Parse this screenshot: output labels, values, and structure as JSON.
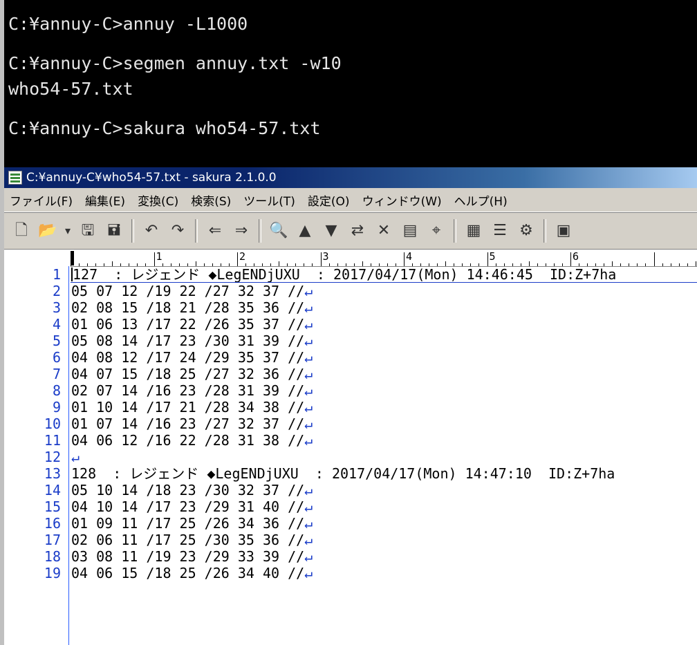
{
  "console": {
    "lines": [
      "C:¥annuy-C>annuy -L1000",
      "",
      "C:¥annuy-C>segmen annuy.txt -w10",
      "who54-57.txt",
      "",
      "C:¥annuy-C>sakura who54-57.txt"
    ]
  },
  "window": {
    "title": "C:¥annuy-C¥who54-57.txt - sakura 2.1.0.0"
  },
  "menu": [
    "ファイル(F)",
    "編集(E)",
    "変換(C)",
    "検索(S)",
    "ツール(T)",
    "設定(O)",
    "ウィンドウ(W)",
    "ヘルプ(H)"
  ],
  "toolbar": {
    "icons": [
      "new-file-icon",
      "open-file-icon",
      "dropdown-arrow-icon",
      "save-icon",
      "save-all-icon",
      "sep",
      "undo-icon",
      "redo-icon",
      "sep",
      "jump-back-icon",
      "jump-forward-icon",
      "sep",
      "find-icon",
      "find-prev-icon",
      "find-next-icon",
      "replace-icon",
      "find-clear-icon",
      "grep-icon",
      "tag-jump-icon",
      "sep",
      "compare-icon",
      "outline-icon",
      "settings-icon",
      "sep",
      "window-list-icon"
    ]
  },
  "ruler": {
    "labels": [
      "1",
      "2",
      "3",
      "4",
      "5",
      "6"
    ]
  },
  "editor": {
    "lines": [
      {
        "n": "1",
        "text": "127  : レジェンド ◆LegENDjUXU  : 2017/04/17(Mon) 14:46:45  ID:Z+7ha",
        "eol": ""
      },
      {
        "n": "2",
        "text": "05 07 12 /19 22 /27 32 37 //",
        "eol": "↵"
      },
      {
        "n": "3",
        "text": "02 08 15 /18 21 /28 35 36 //",
        "eol": "↵"
      },
      {
        "n": "4",
        "text": "01 06 13 /17 22 /26 35 37 //",
        "eol": "↵"
      },
      {
        "n": "5",
        "text": "05 08 14 /17 23 /30 31 39 //",
        "eol": "↵"
      },
      {
        "n": "6",
        "text": "04 08 12 /17 24 /29 35 37 //",
        "eol": "↵"
      },
      {
        "n": "7",
        "text": "04 07 15 /18 25 /27 32 36 //",
        "eol": "↵"
      },
      {
        "n": "8",
        "text": "02 07 14 /16 23 /28 31 39 //",
        "eol": "↵"
      },
      {
        "n": "9",
        "text": "01 10 14 /17 21 /28 34 38 //",
        "eol": "↵"
      },
      {
        "n": "10",
        "text": "01 07 14 /16 23 /27 32 37 //",
        "eol": "↵"
      },
      {
        "n": "11",
        "text": "04 06 12 /16 22 /28 31 38 //",
        "eol": "↵"
      },
      {
        "n": "12",
        "text": "",
        "eol": "↵"
      },
      {
        "n": "13",
        "text": "128  : レジェンド ◆LegENDjUXU  : 2017/04/17(Mon) 14:47:10  ID:Z+7ha",
        "eol": ""
      },
      {
        "n": "14",
        "text": "05 10 14 /18 23 /30 32 37 //",
        "eol": "↵"
      },
      {
        "n": "15",
        "text": "04 10 14 /17 23 /29 31 40 //",
        "eol": "↵"
      },
      {
        "n": "16",
        "text": "01 09 11 /17 25 /26 34 36 //",
        "eol": "↵"
      },
      {
        "n": "17",
        "text": "02 06 11 /17 25 /30 35 36 //",
        "eol": "↵"
      },
      {
        "n": "18",
        "text": "03 08 11 /19 23 /29 33 39 //",
        "eol": "↵"
      },
      {
        "n": "19",
        "text": "04 06 15 /18 25 /26 34 40 //",
        "eol": "↵"
      }
    ]
  }
}
